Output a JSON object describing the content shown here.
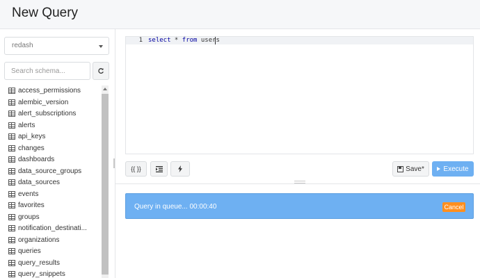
{
  "header": {
    "title": "New Query"
  },
  "sidebar": {
    "data_source": "redash",
    "search_placeholder": "Search schema...",
    "tables": [
      "access_permissions",
      "alembic_version",
      "alert_subscriptions",
      "alerts",
      "api_keys",
      "changes",
      "dashboards",
      "data_source_groups",
      "data_sources",
      "events",
      "favorites",
      "groups",
      "notification_destinati...",
      "organizations",
      "queries",
      "query_results",
      "query_snippets"
    ]
  },
  "editor": {
    "line_number": "1",
    "code_kw1": "select",
    "code_mid": " * ",
    "code_kw2": "from",
    "code_tail": " users"
  },
  "toolbar": {
    "params_label": "{{ }}",
    "format_icon": "indent-icon",
    "autocomplete_icon": "bolt-icon",
    "save_label": "Save*",
    "execute_label": "Execute"
  },
  "status": {
    "message": "Query in queue... 00:00:40",
    "cancel_label": "Cancel"
  },
  "colors": {
    "execute": "#6eb0f2",
    "alert": "#6eb0f2",
    "cancel": "#ff8f1f"
  }
}
